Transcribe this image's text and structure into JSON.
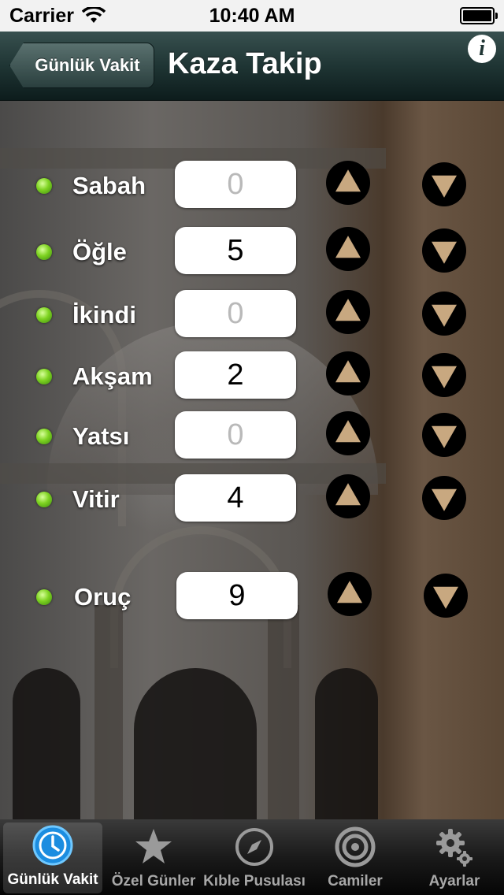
{
  "status_bar": {
    "carrier": "Carrier",
    "time": "10:40 AM"
  },
  "nav": {
    "back_label": "Günlük Vakit",
    "title": "Kaza Takip",
    "info_icon": "info-icon",
    "info_glyph": "i"
  },
  "rows": [
    {
      "label": "Sabah",
      "value": "0"
    },
    {
      "label": "Öğle",
      "value": "5"
    },
    {
      "label": "İkindi",
      "value": "0"
    },
    {
      "label": "Akşam",
      "value": "2"
    },
    {
      "label": "Yatsı",
      "value": "0"
    },
    {
      "label": "Vitir",
      "value": "4"
    },
    {
      "label": "Oruç",
      "value": "9"
    }
  ],
  "tabs": [
    {
      "label": "Günlük Vakit",
      "icon": "clock-icon",
      "active": true
    },
    {
      "label": "Özel Günler",
      "icon": "star-icon",
      "active": false
    },
    {
      "label": "Kıble Pusulası",
      "icon": "compass-icon",
      "active": false
    },
    {
      "label": "Camiler",
      "icon": "target-icon",
      "active": false
    },
    {
      "label": "Ayarlar",
      "icon": "gear-icon",
      "active": false
    }
  ],
  "colors": {
    "indicator": "#7ed321",
    "arrow": "#c8a880",
    "active_tab_icon": "#29a8ff"
  }
}
